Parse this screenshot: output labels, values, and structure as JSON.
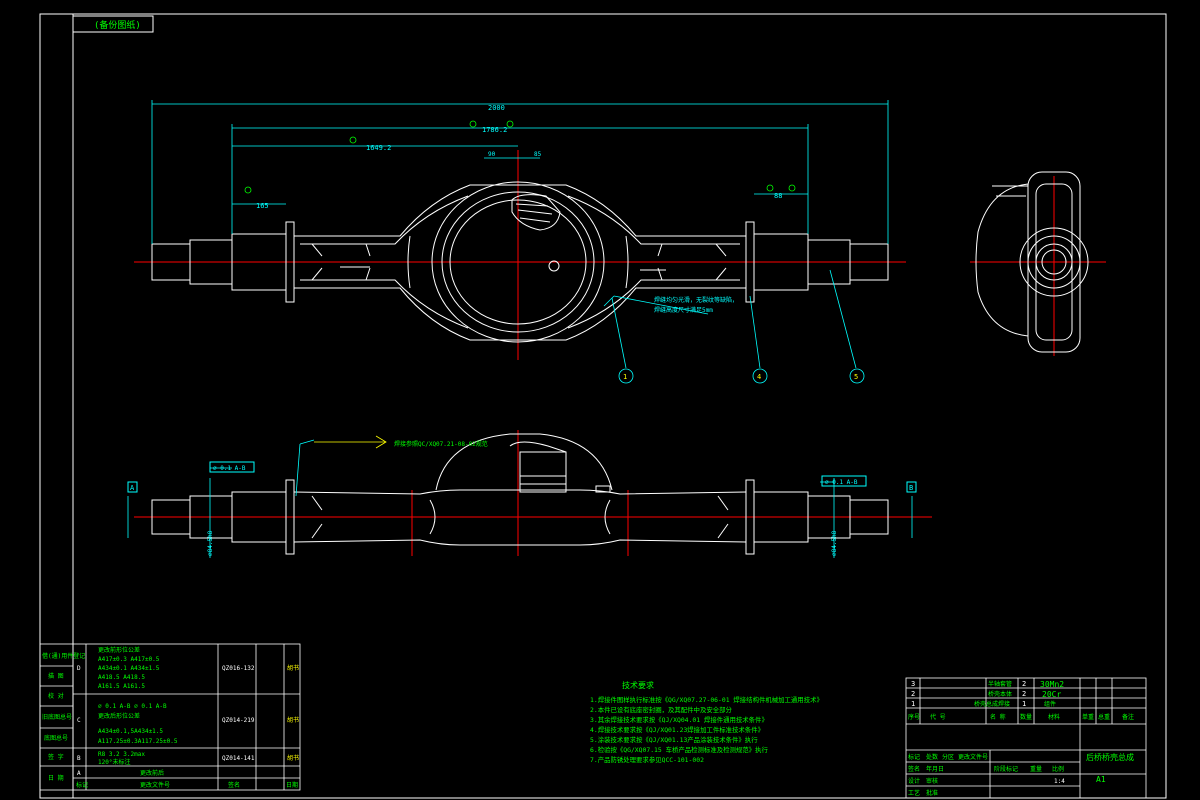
{
  "colors": {
    "background": "#000000",
    "outline": "#ffffff",
    "dimension": "#00ffff",
    "centerline": "#ff0000",
    "note": "#00ff00",
    "leader": "#ffff00"
  },
  "labels": {
    "corner_tag": "(备份图纸)",
    "dim_overall": "2000",
    "dim_span": "1786.2",
    "dim_inner": "1649.2",
    "dim_end_left": "165",
    "dim_end_right": "88",
    "dim_c1": "90",
    "dim_c2": "85",
    "housing_note_1": "焊缝均匀光滑，无裂纹等缺陷，",
    "housing_note_2": "焊缝高度尺寸满足5mm",
    "balloons": [
      "1",
      "4",
      "5"
    ],
    "datum_a": "A",
    "datum_b": "B",
    "tol_left": "⌀ 0.1  A-B",
    "tol_right": "⌀ 0.1  A-B",
    "weld_note": "焊接参照QC/XQ07.21-08-02规范",
    "vert_dim_1": "⌀84.5h8",
    "vert_dim_2": "⌀84.5h8"
  },
  "rev_table": {
    "side_labels": [
      "借(通)用件登记",
      "描 图",
      "校 对",
      "旧底图总号",
      "底图总号",
      "签 字",
      "日 期"
    ],
    "rows": [
      {
        "zone": "D",
        "lines": [
          "更改前形位公差",
          "A417±0.3  A417±0.5",
          "A434±0.1  A434±1.5",
          "A418.5    A418.5",
          "A161.5    A161.5"
        ],
        "code": "QZ016-132",
        "sign": "胡书"
      },
      {
        "zone": "C",
        "lines": [
          "⌀ 0.1 A-B   ⌀ 0.1 A-B",
          "更改后形位公差",
          "A434±0.1,5A434±1.5",
          "A117.25±0.3A117.25±0.5"
        ],
        "code": "QZ014-219",
        "sign": "胡书"
      },
      {
        "zone": "B",
        "lines": [
          "R8  3.2     3.2max",
          "120°未标注"
        ],
        "code": "QZ014-141",
        "sign": "胡书"
      },
      {
        "zone": "A",
        "lines": [
          "更改前后"
        ],
        "code": "",
        "sign": ""
      }
    ],
    "footer": [
      "标记",
      "更改文件号",
      "签名",
      "日期"
    ]
  },
  "tech_req": {
    "title": "技术要求",
    "items": [
      "1.焊接件图样执行标准按《QG/XQ07.27-06-01  焊接结构件机械加工通用技术》",
      "2.本件已设有底座密封圈，及其配件中及安全部分",
      "3.其余焊接技术要求按《QJ/XQ04.01  焊接件通用技术条件》",
      "4.焊接技术要求按《QJ/XQ01.23焊接加工件标准技术条件》",
      "5.涂装技术要求按《QJ/XQ01.13产品涂装技术条件》执行",
      "6.检验按《QG/XQ07.15 车桥产品检测标准及检测规范》执行",
      "7.产品防锈处理要求参见QCC-101-002"
    ]
  },
  "bom": {
    "rows": [
      {
        "no": "3",
        "name": "半轴套管",
        "qty": "2",
        "material": "30Mn2"
      },
      {
        "no": "2",
        "name": "桥壳本体",
        "qty": "2",
        "material": "20Cr"
      },
      {
        "no": "1",
        "name": "桥壳总成焊接",
        "qty": "1",
        "material": "组件"
      }
    ],
    "header": [
      "序号",
      "代  号",
      "名  称",
      "数量",
      "材料",
      "单重",
      "总重",
      "备注"
    ],
    "title": "后桥桥壳总成",
    "sheet": "A1",
    "scale_label": "1:4",
    "title_block_cells": [
      "标记",
      "处数",
      "分区",
      "更改文件号",
      "签名",
      "年月日",
      "设计",
      "审核",
      "工艺",
      "批准",
      "阶段标记",
      "重量",
      "比例"
    ]
  }
}
